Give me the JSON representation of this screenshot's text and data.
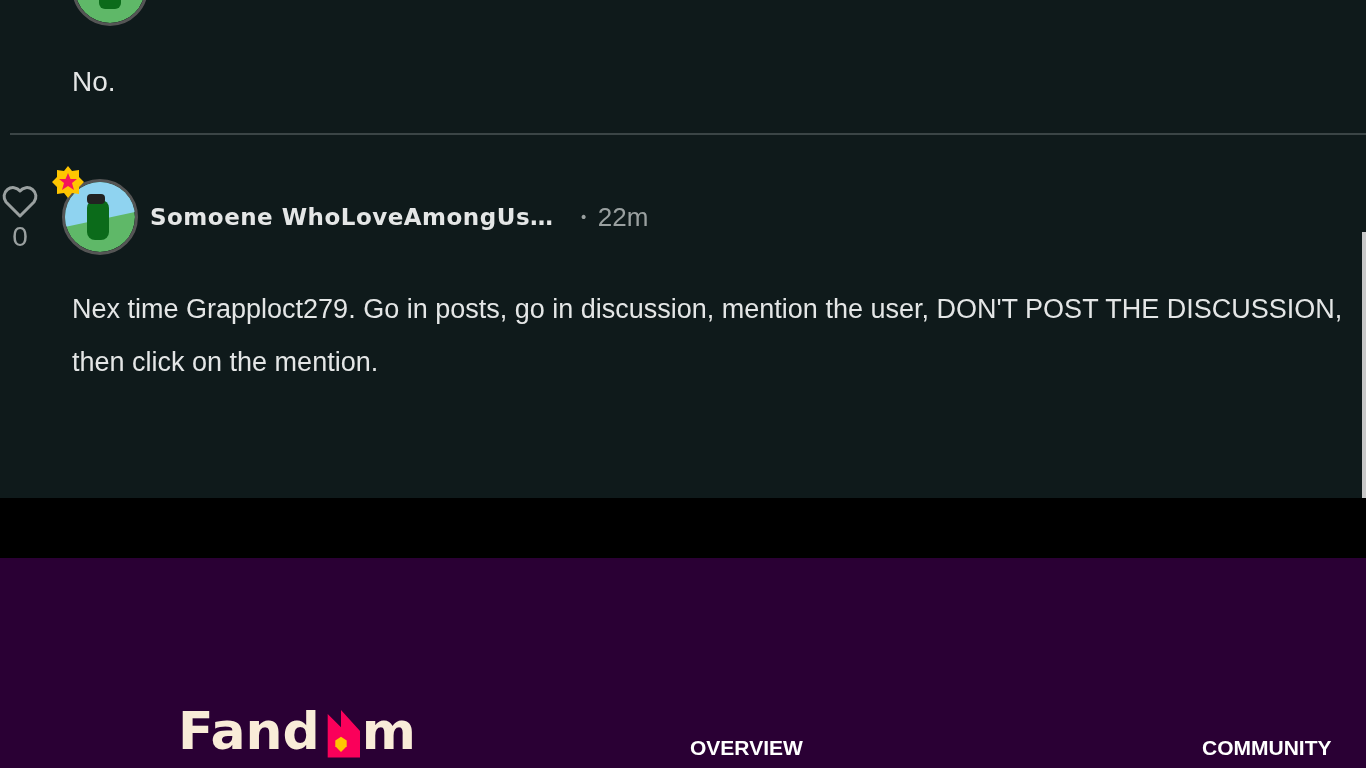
{
  "previous_comment": {
    "text": "No."
  },
  "comment": {
    "likes": "0",
    "author": "Somoene WhoLoveAmongUs…",
    "separator": "•",
    "time": "22m",
    "star_badge": true,
    "text": "Nex time Grapploct279. Go in posts, go in discussion, mention the user, DON'T POST THE DISCUSSION, then click on the mention."
  },
  "footer": {
    "logo": [
      "Fand",
      "m"
    ],
    "headings": [
      "OVERVIEW",
      "COMMUNITY"
    ]
  }
}
